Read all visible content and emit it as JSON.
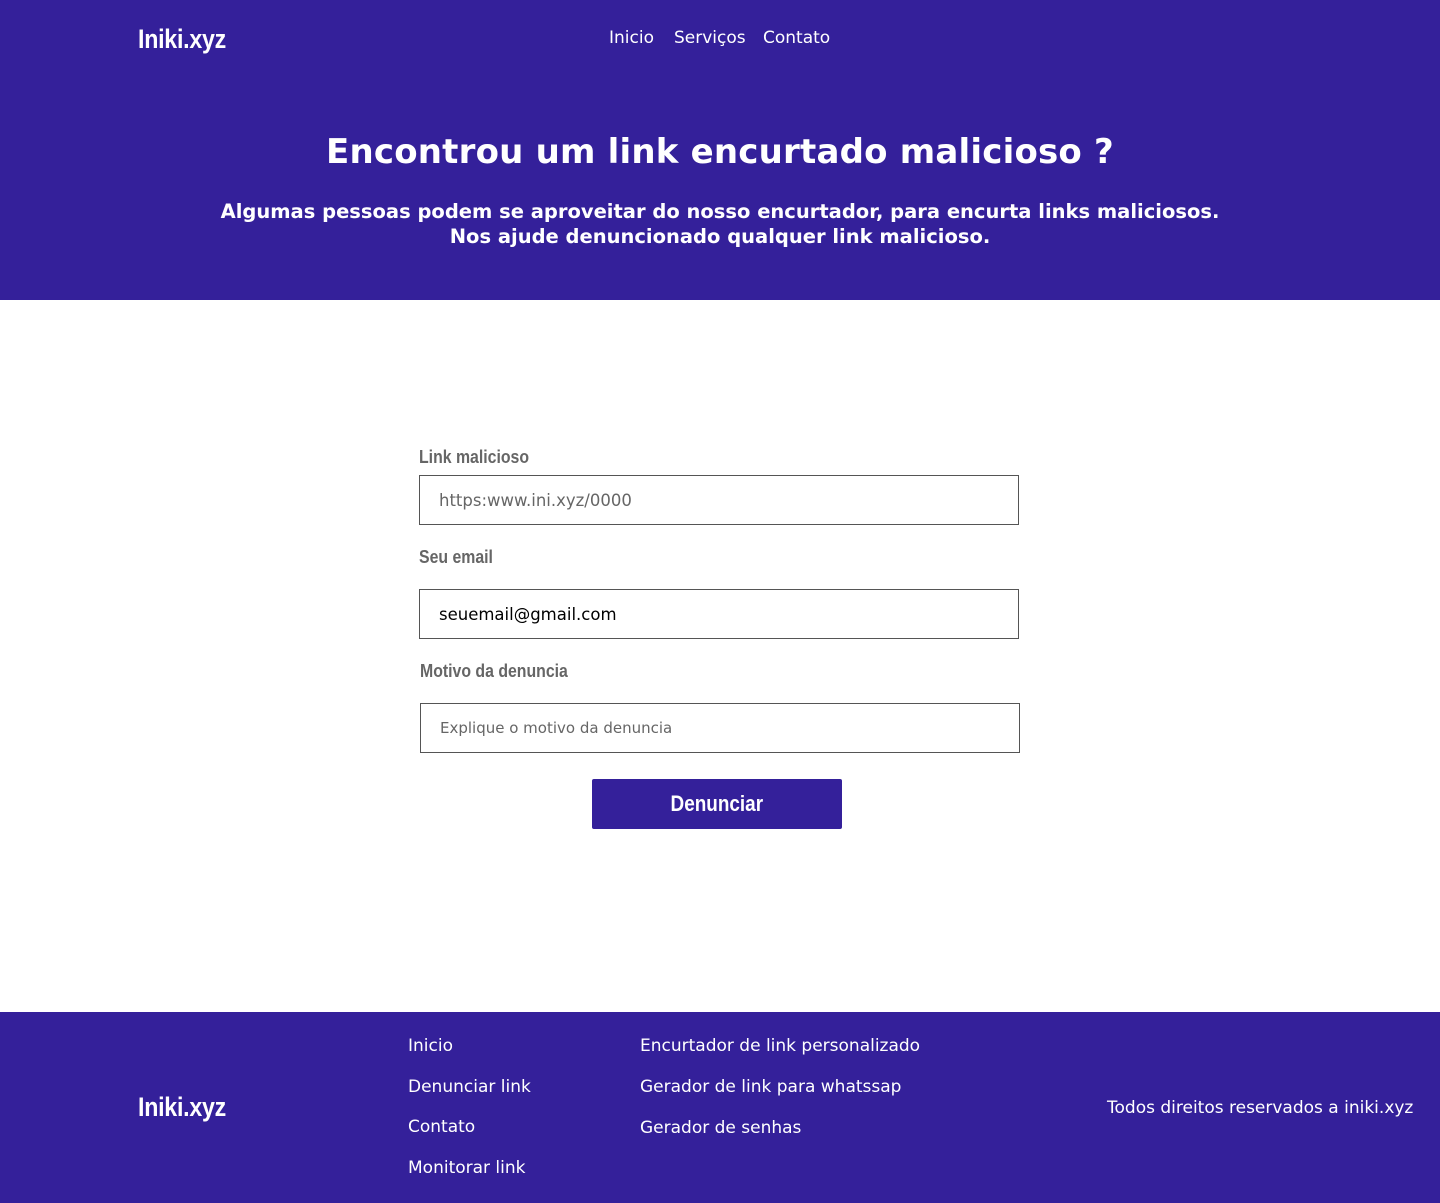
{
  "header": {
    "logo": "Iniki.xyz",
    "nav": [
      "Inicio",
      "Serviços",
      "Contato"
    ]
  },
  "hero": {
    "title": "Encontrou um link encurtado malicioso ?",
    "subtitle_line1": "Algumas pessoas podem se aproveitar do nosso encurtador, para encurta links maliciosos.",
    "subtitle_line2": "Nos ajude denuncionado qualquer link malicioso."
  },
  "form": {
    "link_label": "Link malicioso",
    "link_placeholder": "https:www.ini.xyz/0000",
    "link_value": "",
    "email_label": "Seu email",
    "email_placeholder": "",
    "email_value": "seuemail@gmail.com",
    "motivo_label": "Motivo da denuncia",
    "motivo_placeholder": "Explique o motivo da denuncia",
    "submit_label": "Denunciar"
  },
  "footer": {
    "logo": "Iniki.xyz",
    "col1": [
      "Inicio",
      "Denunciar link",
      "Contato",
      "Monitorar link"
    ],
    "col2": [
      "Encurtador de link personalizado",
      "Gerador de link para whatssap",
      "Gerador de senhas"
    ],
    "copyright": "Todos direitos reservados a iniki.xyz"
  },
  "colors": {
    "brand": "#34209a",
    "background": "#ffffff",
    "label_text": "#666666"
  }
}
